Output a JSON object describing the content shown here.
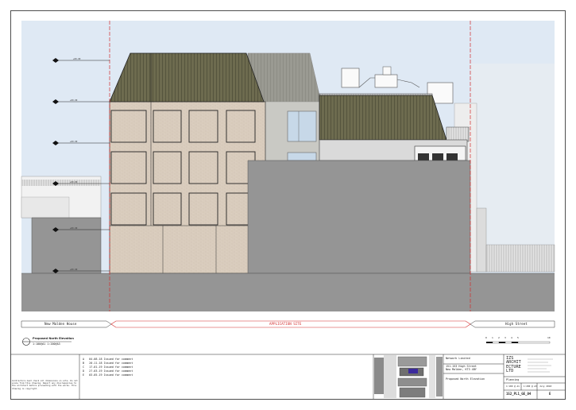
{
  "drawing": {
    "labels": {
      "left_boundary": "New Malden House",
      "site": "APPLICATION SITE",
      "right_boundary": "High Street"
    },
    "view_title": "Proposed North Elevation",
    "view_scale": "1:100@A1 1:200@A3",
    "levels": [
      "+00.00",
      "+00.00",
      "+00.00",
      "+00.00",
      "+00.00",
      "+00.00"
    ],
    "scale_bar": [
      "0",
      "1",
      "2",
      "3",
      "4",
      "5",
      "10"
    ]
  },
  "revisions": [
    {
      "rev": "A",
      "date": "04.08.18",
      "desc": "Issued for comment"
    },
    {
      "rev": "B",
      "date": "20.11.18",
      "desc": "Issued for comment"
    },
    {
      "rev": "C",
      "date": "17.01.19",
      "desc": "Issued for comment"
    },
    {
      "rev": "D",
      "date": "27.03.19",
      "desc": "Issued for comment"
    },
    {
      "rev": "E",
      "date": "03.05.19",
      "desc": "Issued for comment"
    }
  ],
  "notes": "Contractors must check all dimensions on site. Do not scale from this drawing. Report any discrepancies to the architect before proceeding with the works. This drawing is copyright.",
  "title_block": {
    "client": "Network Limited",
    "project_line1": "151-153 High Street",
    "project_line2": "New Malden, KT3 4BY",
    "drawing_title": "Proposed North Elevation",
    "logo_lines": [
      "IZS",
      "ARCHIT",
      "ECTURE",
      "LTD"
    ],
    "status": "Planning",
    "scale": "1:100 @ A1 - 1:200 @ A3",
    "date": "July 2018",
    "drawing_no": "152_PL1_GE_04",
    "revision": "E"
  },
  "colors": {
    "sky": "#dfe9f4",
    "ground": "#959595",
    "roof": "#6b6a4f",
    "brick": "#d8cbbc",
    "site_line": "#d22b2b"
  }
}
